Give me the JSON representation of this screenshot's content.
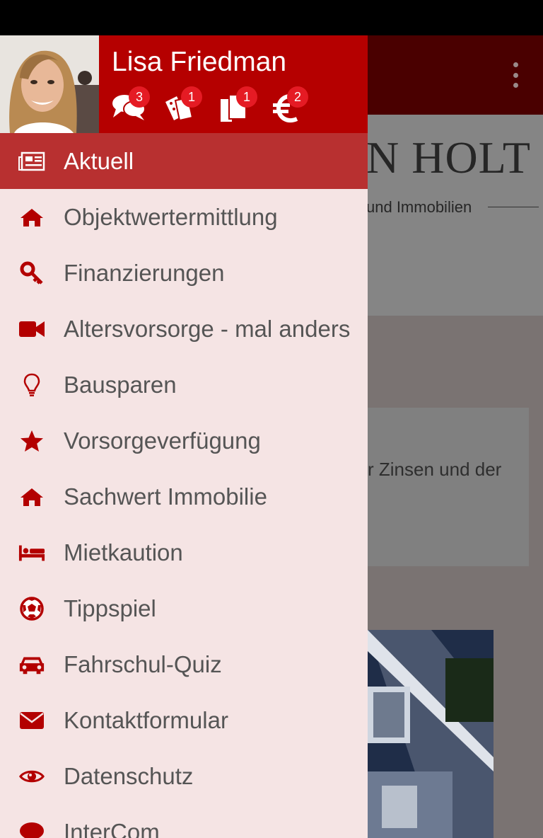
{
  "user": {
    "name": "Lisa Friedman"
  },
  "badges": [
    {
      "icon": "chat-icon",
      "count": "3"
    },
    {
      "icon": "coupon-icon",
      "count": "1"
    },
    {
      "icon": "documents-icon",
      "count": "1"
    },
    {
      "icon": "euro-icon",
      "count": "2"
    }
  ],
  "menu": [
    {
      "label": "Aktuell",
      "icon": "newspaper-icon",
      "active": true
    },
    {
      "label": "Objektwertermittlung",
      "icon": "home-icon"
    },
    {
      "label": "Finanzierungen",
      "icon": "key-icon"
    },
    {
      "label": "Altersvorsorge - mal anders",
      "icon": "video-camera-icon"
    },
    {
      "label": "Bausparen",
      "icon": "lightbulb-icon"
    },
    {
      "label": "Vorsorgeverfügung",
      "icon": "star-icon"
    },
    {
      "label": "Sachwert Immobilie",
      "icon": "home-icon"
    },
    {
      "label": "Mietkaution",
      "icon": "bed-icon"
    },
    {
      "label": "Tippspiel",
      "icon": "soccer-ball-icon"
    },
    {
      "label": "Fahrschul-Quiz",
      "icon": "car-icon"
    },
    {
      "label": "Kontaktformular",
      "icon": "envelope-icon"
    },
    {
      "label": "Datenschutz",
      "icon": "eye-icon"
    },
    {
      "label": "InterCom",
      "icon": "chat-bubble-icon"
    }
  ],
  "background": {
    "logo_title": "N HOLT",
    "logo_subtitle": "und Immobilien",
    "card_text": "r Zinsen und der"
  },
  "colors": {
    "header_red": "#b50000",
    "active_item": "#b83030",
    "icon_red": "#b30000",
    "badge_red": "#e51b24",
    "drawer_bg": "#f5e4e4"
  }
}
